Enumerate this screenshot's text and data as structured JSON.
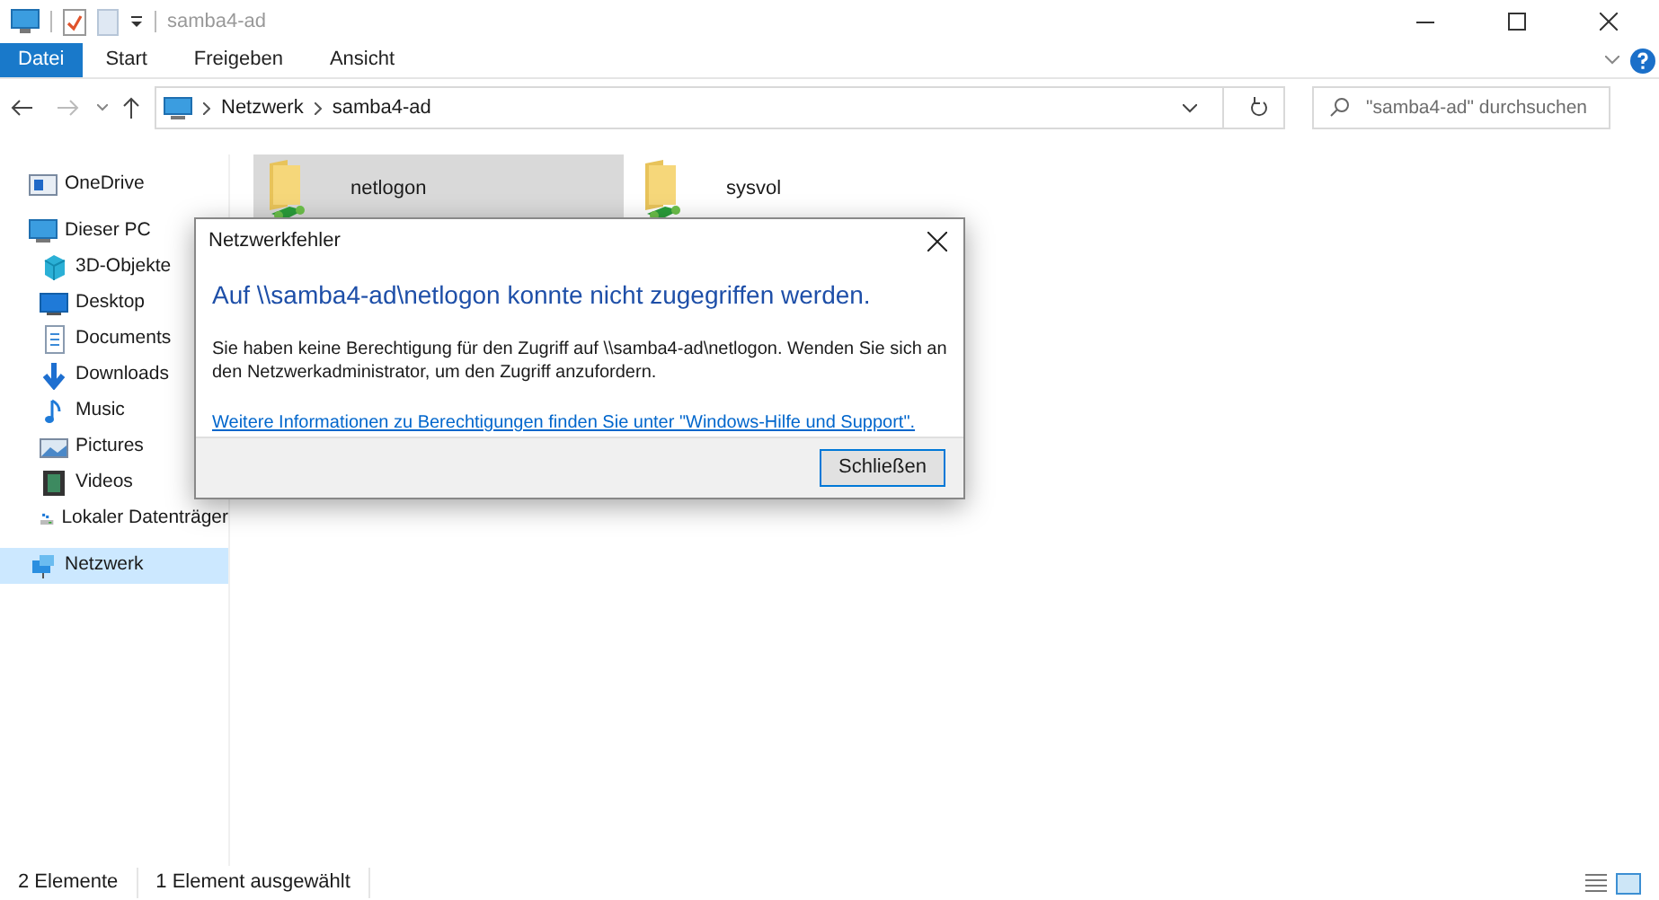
{
  "window": {
    "title": "samba4-ad"
  },
  "ribbon_tabs": [
    {
      "label": "Datei",
      "selected": true
    },
    {
      "label": "Start",
      "selected": false
    },
    {
      "label": "Freigeben",
      "selected": false
    },
    {
      "label": "Ansicht",
      "selected": false
    }
  ],
  "address_bar": {
    "path": [
      "Netzwerk",
      "samba4-ad"
    ]
  },
  "search": {
    "placeholder": "\"samba4-ad\" durchsuchen"
  },
  "sidebar": {
    "items": [
      {
        "label": "OneDrive",
        "selected": false
      },
      {
        "label": "Dieser PC",
        "selected": false,
        "children": [
          {
            "label": "3D-Objekte",
            "selected": false
          },
          {
            "label": "Desktop",
            "selected": false
          },
          {
            "label": "Documents",
            "selected": false
          },
          {
            "label": "Downloads",
            "selected": false
          },
          {
            "label": "Music",
            "selected": false
          },
          {
            "label": "Pictures",
            "selected": false
          },
          {
            "label": "Videos",
            "selected": false
          },
          {
            "label": "Lokaler Datenträger",
            "selected": false
          }
        ]
      },
      {
        "label": "Netzwerk",
        "selected": true
      }
    ]
  },
  "files": [
    {
      "name": "netlogon",
      "selected": true
    },
    {
      "name": "sysvol",
      "selected": false
    }
  ],
  "dialog": {
    "title": "Netzwerkfehler",
    "heading": "Auf \\\\samba4-ad\\netlogon konnte nicht zugegriffen werden.",
    "message": "Sie haben keine Berechtigung für den Zugriff auf \\\\samba4-ad\\netlogon. Wenden Sie sich an den Netzwerkadministrator, um den Zugriff anzufordern.",
    "link": "Weitere Informationen zu Berechtigungen finden Sie unter \"Windows-Hilfe und Support\".",
    "button": "Schließen"
  },
  "status_bar": {
    "item_count": "2 Elemente",
    "selection": "1 Element ausgewählt"
  }
}
